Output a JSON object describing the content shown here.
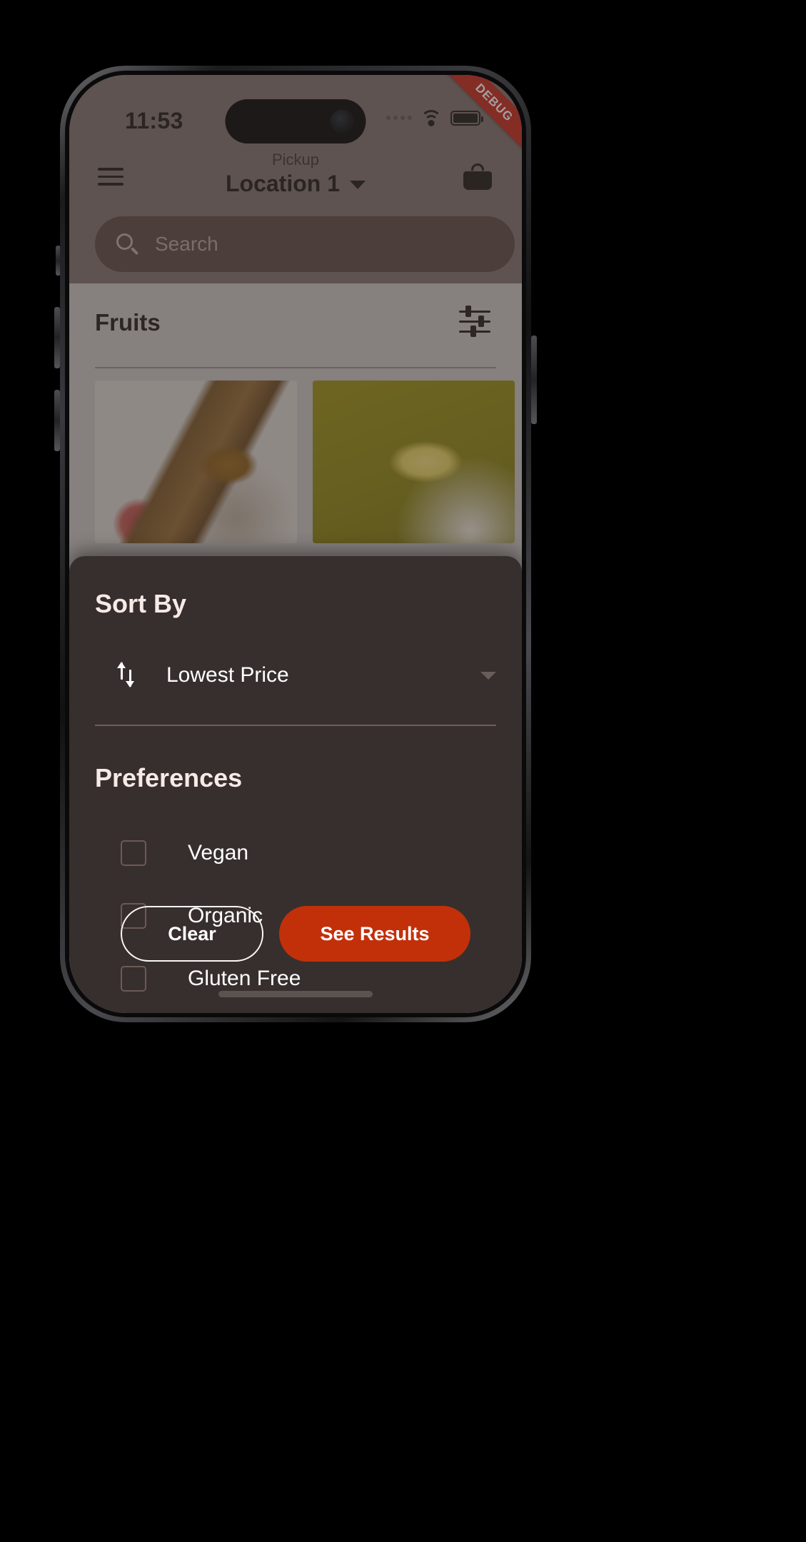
{
  "status_bar": {
    "time": "11:53",
    "signal_icon": "signal-dots-icon",
    "wifi_icon": "wifi-icon",
    "battery_icon": "battery-icon",
    "debug_label": "DEBUG"
  },
  "app_bar": {
    "menu_icon": "hamburger-menu-icon",
    "mode_label": "Pickup",
    "location_label": "Location 1",
    "location_caret_icon": "caret-down-icon",
    "cart_icon": "shopping-basket-icon"
  },
  "search": {
    "icon": "search-icon",
    "placeholder": "Search",
    "value": ""
  },
  "category": {
    "title": "Fruits",
    "filter_icon": "tune-filter-icon",
    "tiles": [
      {
        "name": "apple-butter-product-image"
      },
      {
        "name": "banana-product-image"
      }
    ]
  },
  "sheet": {
    "sort_heading": "Sort By",
    "sort_icon": "sort-arrows-icon",
    "sort_selected": "Lowest Price",
    "sort_caret_icon": "caret-down-icon",
    "preferences_heading": "Preferences",
    "preferences": [
      {
        "label": "Vegan",
        "checked": false
      },
      {
        "label": "Organic",
        "checked": false
      },
      {
        "label": "Gluten Free",
        "checked": false
      }
    ],
    "clear_label": "Clear",
    "results_label": "See Results"
  },
  "colors": {
    "header_bg": "#7e6f6b",
    "search_bg": "#5a4742",
    "sheet_bg": "#372f2d",
    "accent": "#c2300a",
    "debug_red": "#c4271a",
    "heading_text": "#f7eae7",
    "divider": "#6e5f5b"
  }
}
